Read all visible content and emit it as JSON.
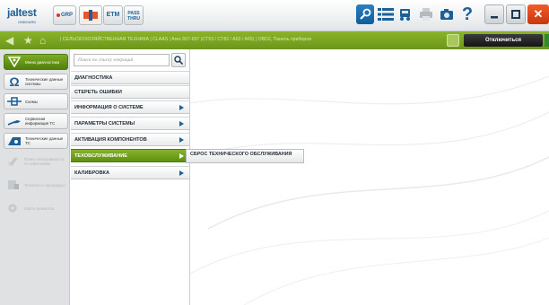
{
  "app": {
    "logo": "jaltest",
    "logo_sub": "ONBOARD"
  },
  "toolbar": {
    "grp_label": "GRP",
    "etm_label": "ETM",
    "pass_label": "PASS THRU",
    "help_label": "?",
    "close_label": "✕"
  },
  "navbar": {
    "breadcrumb": "| СЕЛЬСКОХОЗЯЙСТВЕННАЯ ТЕХНИКА | CLAAS | Ares 657-697 (CT53 / CT82 / A63 / A65) | OBD2, Панель приборов",
    "disconnect_label": "Отключиться"
  },
  "sidebar": {
    "items": [
      {
        "label": "Меню диагностики",
        "icon": "diagnosis-menu-icon",
        "state": "active"
      },
      {
        "label": "Технические данные системы",
        "icon": "omega-icon",
        "state": "normal"
      },
      {
        "label": "Схемы",
        "icon": "schematic-icon",
        "state": "normal"
      },
      {
        "label": "Сервисная информация ТС",
        "icon": "service-info-icon",
        "state": "normal"
      },
      {
        "label": "Технические данные ТС",
        "icon": "vehicle-data-icon",
        "state": "normal"
      },
      {
        "label": "Поиск неисправности по симптомам",
        "icon": "symptom-search-icon",
        "state": "disabled"
      },
      {
        "label": "Техничес-к процедуры",
        "icon": "procedures-icon",
        "state": "disabled"
      },
      {
        "label": "Карты ремонтов",
        "icon": "repair-cards-icon",
        "state": "disabled"
      }
    ]
  },
  "search": {
    "placeholder": "Поиск по списку операций"
  },
  "operations": [
    {
      "label": "ДИАГНОСТИКА",
      "has_arrow": false,
      "selected": false
    },
    {
      "label": "СТЕРЕТЬ ОШИБКИ",
      "has_arrow": false,
      "selected": false
    },
    {
      "label": "ИНФОРМАЦИЯ О СИСТЕМЕ",
      "has_arrow": true,
      "selected": false
    },
    {
      "label": "ПАРАМЕТРЫ СИСТЕМЫ",
      "has_arrow": true,
      "selected": false
    },
    {
      "label": "АКТИВАЦИЯ КОМПОНЕНТОВ",
      "has_arrow": true,
      "selected": false
    },
    {
      "label": "ТЕХОБСЛУЖИВАНИЕ",
      "has_arrow": true,
      "selected": true
    },
    {
      "label": "КАЛИБРОВКА",
      "has_arrow": true,
      "selected": false
    }
  ],
  "submenu": {
    "items": [
      "СБРОС ТЕХНИЧЕСКОГО ОБСЛУЖИВАНИЯ"
    ]
  },
  "colors": {
    "accent_green": "#6c961a",
    "brand_blue": "#1d5f97",
    "close_red": "#d9411a"
  }
}
